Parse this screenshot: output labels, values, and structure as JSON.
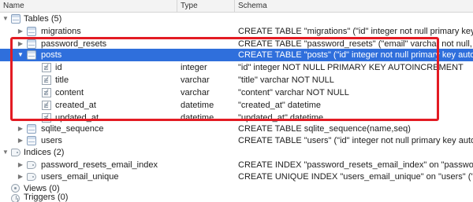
{
  "header": {
    "name": "Name",
    "type": "Type",
    "schema": "Schema"
  },
  "tree": {
    "tables_group": {
      "label": "Tables (5)"
    },
    "tables": [
      {
        "name": "migrations",
        "schema": "CREATE TABLE \"migrations\" (\"id\" integer not null primary key autoincrement"
      },
      {
        "name": "password_resets",
        "schema": "CREATE TABLE \"password_resets\" (\"email\" varchar not null, \"token\""
      },
      {
        "name": "posts",
        "schema": "CREATE TABLE \"posts\" (\"id\" integer not null primary key autoincrement"
      },
      {
        "name": "sqlite_sequence",
        "schema": "CREATE TABLE sqlite_sequence(name,seq)"
      },
      {
        "name": "users",
        "schema": "CREATE TABLE \"users\" (\"id\" integer not null primary key autoincrement"
      }
    ],
    "posts_columns": [
      {
        "name": "id",
        "type": "integer",
        "schema": "\"id\" integer NOT NULL PRIMARY KEY AUTOINCREMENT"
      },
      {
        "name": "title",
        "type": "varchar",
        "schema": "\"title\" varchar NOT NULL"
      },
      {
        "name": "content",
        "type": "varchar",
        "schema": "\"content\" varchar NOT NULL"
      },
      {
        "name": "created_at",
        "type": "datetime",
        "schema": "\"created_at\" datetime"
      },
      {
        "name": "updated_at",
        "type": "datetime",
        "schema": "\"updated_at\" datetime"
      }
    ],
    "indices_group": {
      "label": "Indices (2)"
    },
    "indices": [
      {
        "name": "password_resets_email_index",
        "schema": "CREATE INDEX \"password_resets_email_index\" on \"password_reset"
      },
      {
        "name": "users_email_unique",
        "schema": "CREATE UNIQUE INDEX \"users_email_unique\" on \"users\" (\"email\")"
      }
    ],
    "views_group": {
      "label": "Views (0)"
    },
    "triggers_group": {
      "label": "Triggers (0)"
    }
  },
  "colors": {
    "selection": "#2f6fdc",
    "highlight_border": "#e31b23"
  }
}
